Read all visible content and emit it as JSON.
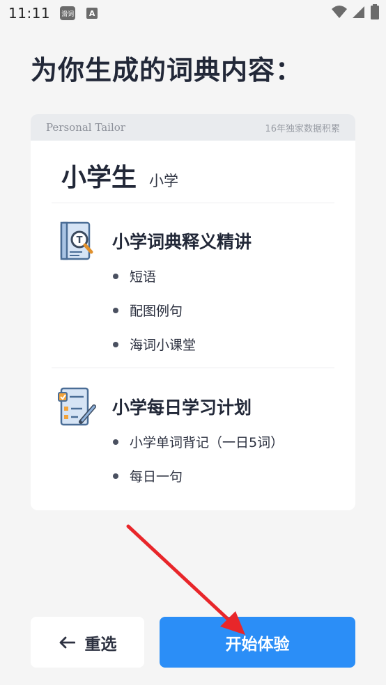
{
  "status_bar": {
    "time": "11:11",
    "app_icon_1": "滑词",
    "app_icon_2": "A"
  },
  "page_title": "为你生成的词典内容：",
  "card": {
    "header_left": "Personal Tailor",
    "header_right": "16年独家数据积累",
    "level_main": "小学生",
    "level_sub": "小学",
    "sections": [
      {
        "icon": "dictionary-search-icon",
        "title": "小学词典释义精讲",
        "items": [
          "短语",
          "配图例句",
          "海词小课堂"
        ]
      },
      {
        "icon": "study-plan-checklist-icon",
        "title": "小学每日学习计划",
        "items": [
          "小学单词背记（一日5词）",
          "每日一句"
        ]
      }
    ]
  },
  "buttons": {
    "reselect": "重选",
    "start": "开始体验"
  },
  "colors": {
    "primary": "#2b8ef7",
    "background": "#f5f5f5",
    "annotation_arrow": "#e8262a"
  }
}
